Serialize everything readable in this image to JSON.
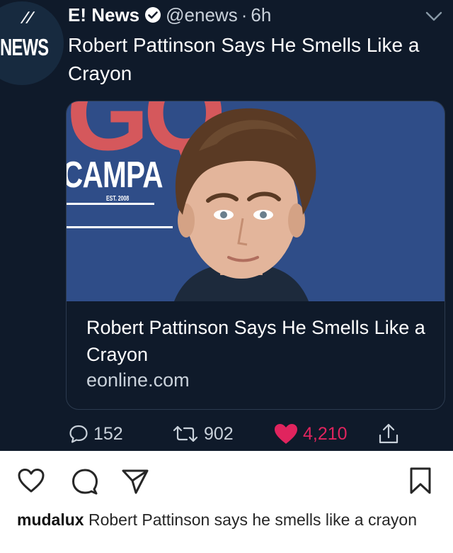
{
  "tweet": {
    "author": {
      "display_name": "E! News",
      "handle": "@enews",
      "separator": "·",
      "time_ago": "6h",
      "verified": true,
      "avatar_text": "NEWS",
      "avatar_mark": "//"
    },
    "headline": "Robert Pattinson Says He Smells Like a Crayon",
    "card": {
      "image_text": {
        "letters": "GQ",
        "sign": "CAMPA",
        "est": "EST. 2008"
      },
      "title": "Robert Pattinson Says He Smells Like a Crayon",
      "domain": "eonline.com"
    },
    "stats": {
      "replies": "152",
      "retweets": "902",
      "likes": "4,210"
    },
    "colors": {
      "background": "#0f1a2a",
      "like": "#e0245e",
      "muted_text": "#c9d1da"
    }
  },
  "instagram": {
    "icons": [
      "heart-icon",
      "comment-icon",
      "share-icon",
      "bookmark-icon"
    ],
    "caption": {
      "username": "mudalux",
      "text": "Robert Pattinson says he smells like a crayon"
    }
  }
}
